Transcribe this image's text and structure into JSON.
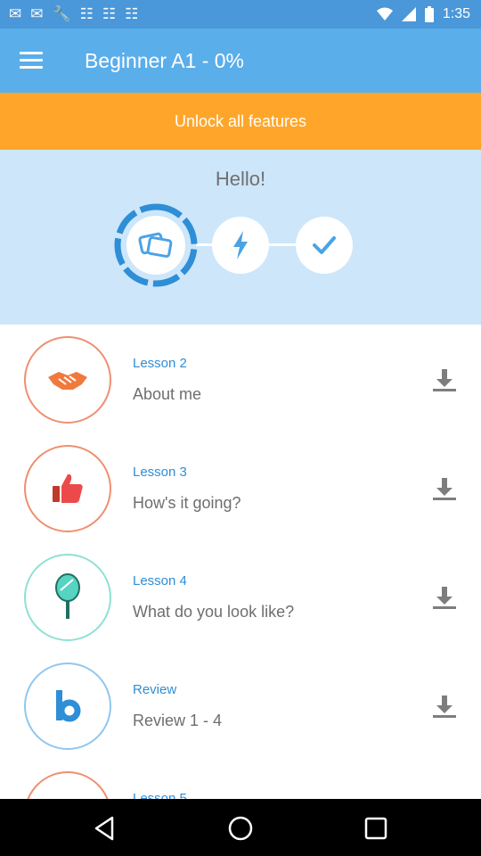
{
  "status_bar": {
    "time": "1:35",
    "left_icons": [
      "message-icon",
      "message-icon",
      "wrench-icon",
      "news-icon",
      "news-icon",
      "news-icon",
      "news-icon",
      "news-icon",
      "news-icon"
    ],
    "right_icons": [
      "wifi-icon",
      "signal-icon",
      "battery-icon"
    ]
  },
  "app_bar": {
    "title": "Beginner A1 - 0%",
    "menu_icon": "menu-icon"
  },
  "unlock_banner": {
    "label": "Unlock all features"
  },
  "hero": {
    "title": "Hello!",
    "steps": [
      {
        "icon": "flashcards-icon",
        "state": "in-progress"
      },
      {
        "icon": "lightning-icon",
        "state": "locked"
      },
      {
        "icon": "checkmark-icon",
        "state": "locked"
      }
    ]
  },
  "lessons": [
    {
      "lesson": "Lesson 2",
      "subtitle": "About me",
      "icon": "handshake-icon",
      "accent": "#ef7c5a"
    },
    {
      "lesson": "Lesson 3",
      "subtitle": "How's it going?",
      "icon": "thumbs-up-icon",
      "accent": "#ef7c5a"
    },
    {
      "lesson": "Lesson 4",
      "subtitle": "What do you look like?",
      "icon": "mirror-icon",
      "accent": "#57d3c2"
    },
    {
      "lesson": "Review",
      "subtitle": "Review 1 - 4",
      "icon": "review-b-icon",
      "accent": "#4aa3e6"
    },
    {
      "lesson": "Lesson 5",
      "subtitle": "",
      "icon": "lesson-icon",
      "accent": "#ef7c5a"
    }
  ],
  "colors": {
    "status_bar": "#4a97d9",
    "app_bar": "#5aaeea",
    "unlock_banner": "#ffa62a",
    "hero_bg": "#cde6fa",
    "lesson_title": "#2e8ed6"
  },
  "nav_bar": {
    "buttons": [
      "back-icon",
      "home-icon",
      "recents-icon"
    ]
  }
}
